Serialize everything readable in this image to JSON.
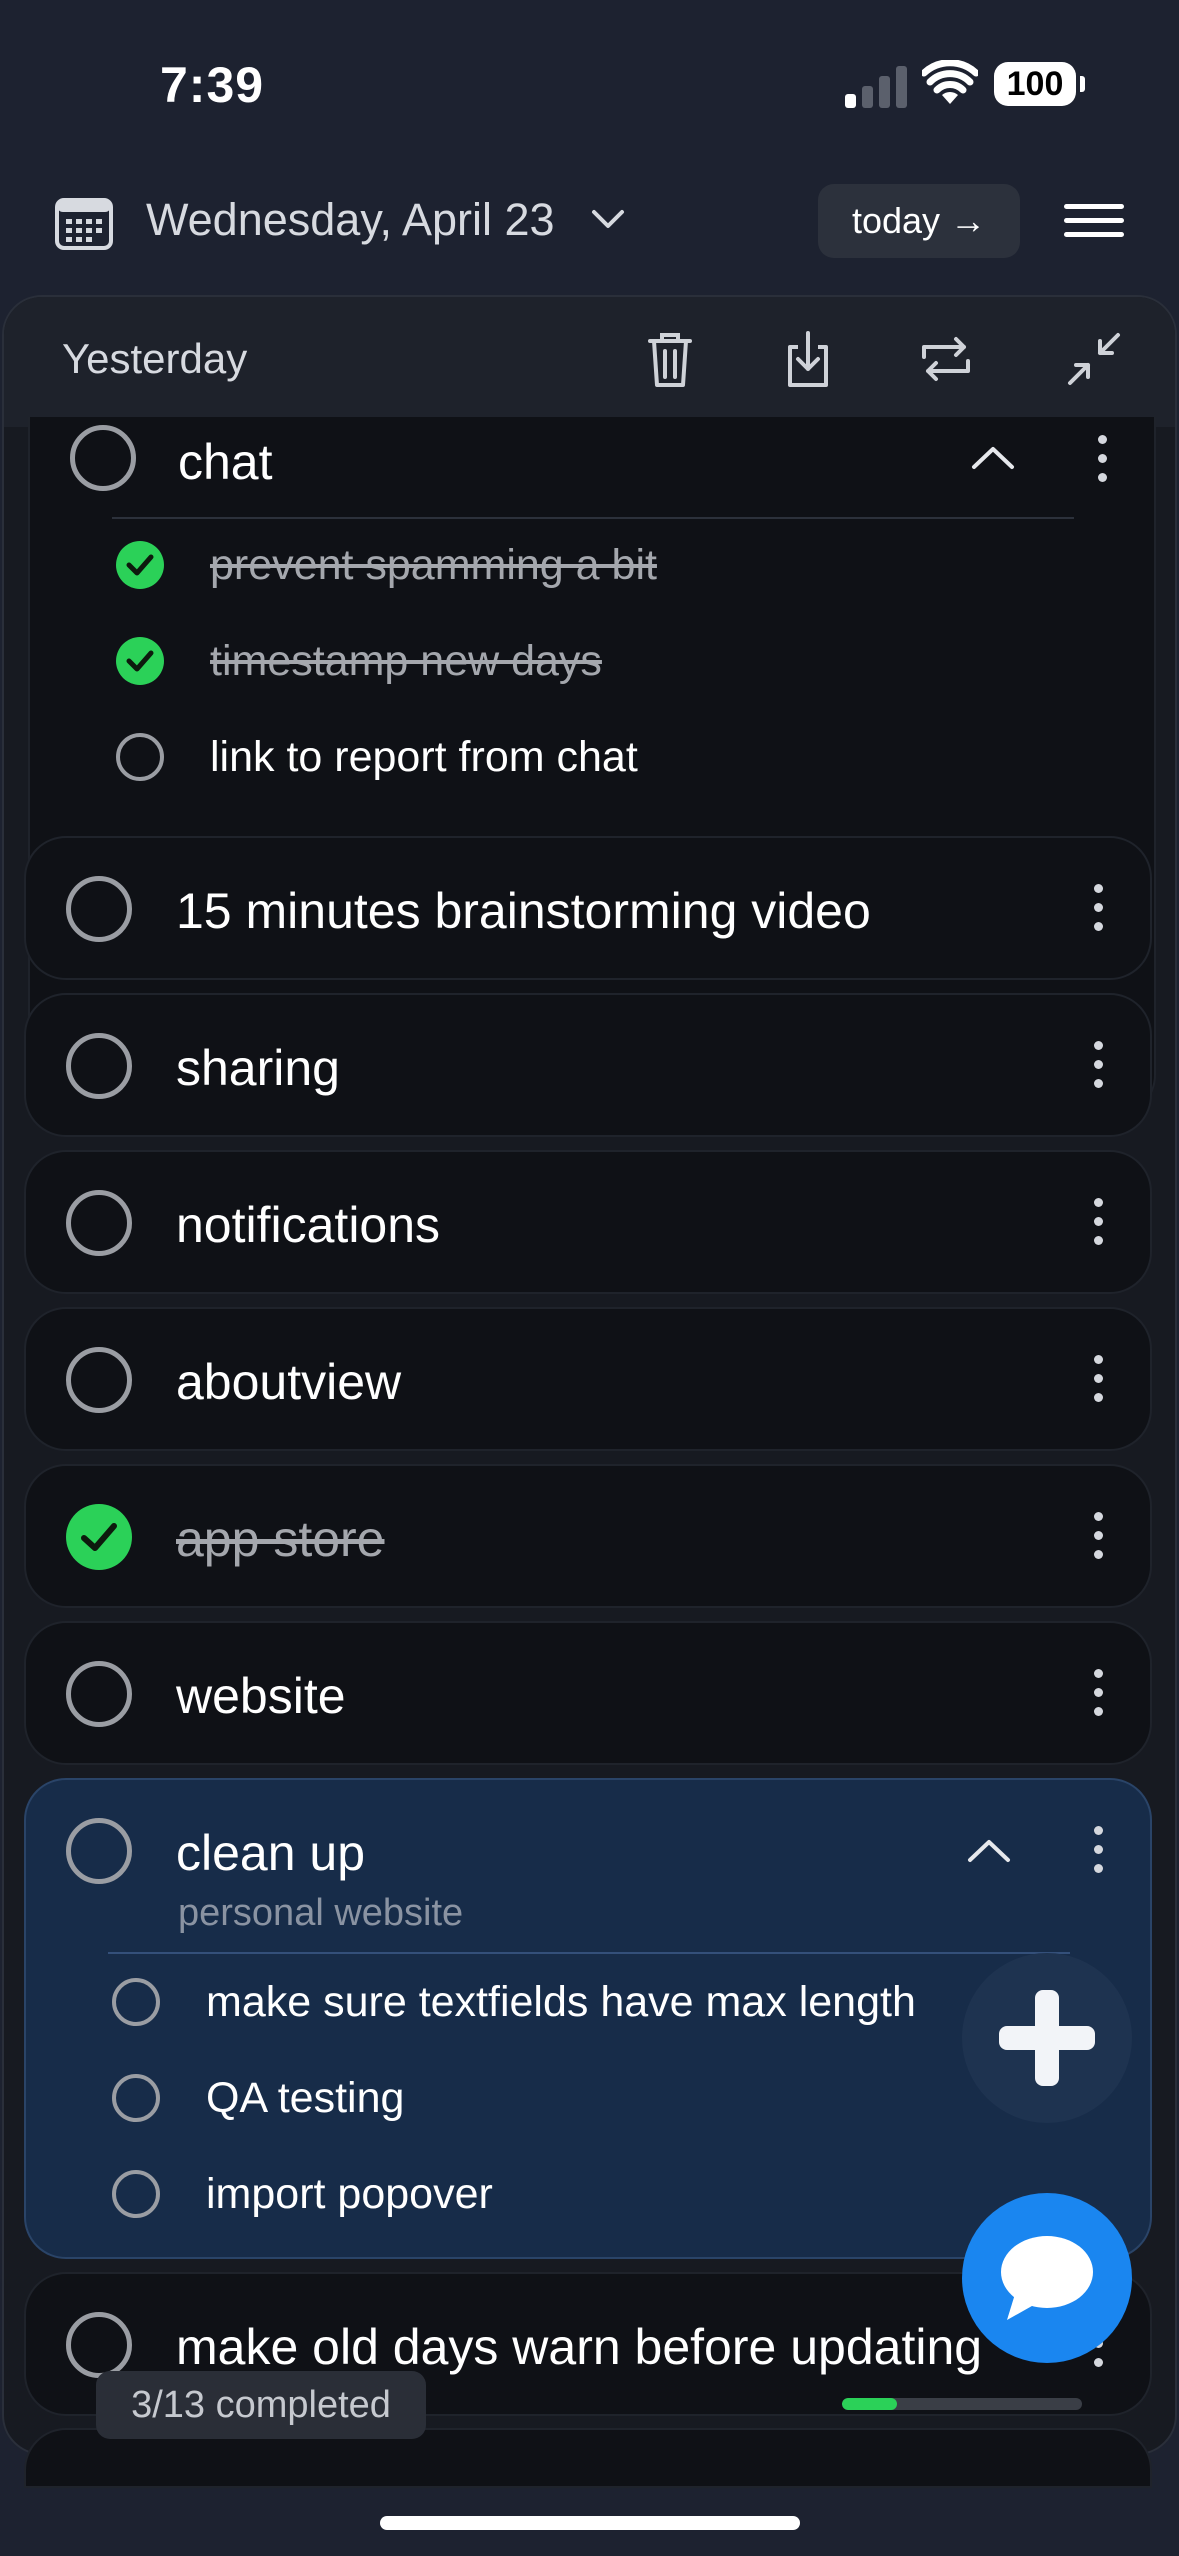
{
  "status_bar": {
    "time": "7:39",
    "battery": "100"
  },
  "header": {
    "date": "Wednesday, April 23",
    "today_label": "today",
    "today_arrow": "→"
  },
  "panel": {
    "title": "Yesterday",
    "tool_icons": [
      "trash-icon",
      "download-icon",
      "repeat-icon",
      "collapse-icon"
    ]
  },
  "tasks": {
    "chat": {
      "title": "chat",
      "subtasks": [
        {
          "text": "prevent spamming a bit",
          "done": true
        },
        {
          "text": "timestamp new days",
          "done": true
        },
        {
          "text": "link to report from chat",
          "done": false
        }
      ]
    },
    "t1": {
      "title": "15 minutes brainstorming video",
      "done": false
    },
    "t2": {
      "title": "sharing",
      "done": false
    },
    "t3": {
      "title": "notifications",
      "done": false
    },
    "t4": {
      "title": "aboutview",
      "done": false
    },
    "t5": {
      "title": "app store",
      "done": true
    },
    "t6": {
      "title": "website",
      "done": false
    },
    "cleanup": {
      "title": "clean up",
      "subtitle": "personal website",
      "subtasks": [
        {
          "text": "make sure textfields have max length",
          "done": false
        },
        {
          "text": "QA testing",
          "done": false
        },
        {
          "text": "import popover",
          "done": false
        }
      ]
    },
    "t7": {
      "title": "make old days warn before updating",
      "done": false
    }
  },
  "footer": {
    "completed_label": "3/13 completed",
    "progress": 0.23
  },
  "colors": {
    "background": "#1d2230",
    "card": "#0f1116",
    "highlight_card": "#172c49",
    "done_green": "#2bd158",
    "chat_blue": "#1a86f0"
  }
}
